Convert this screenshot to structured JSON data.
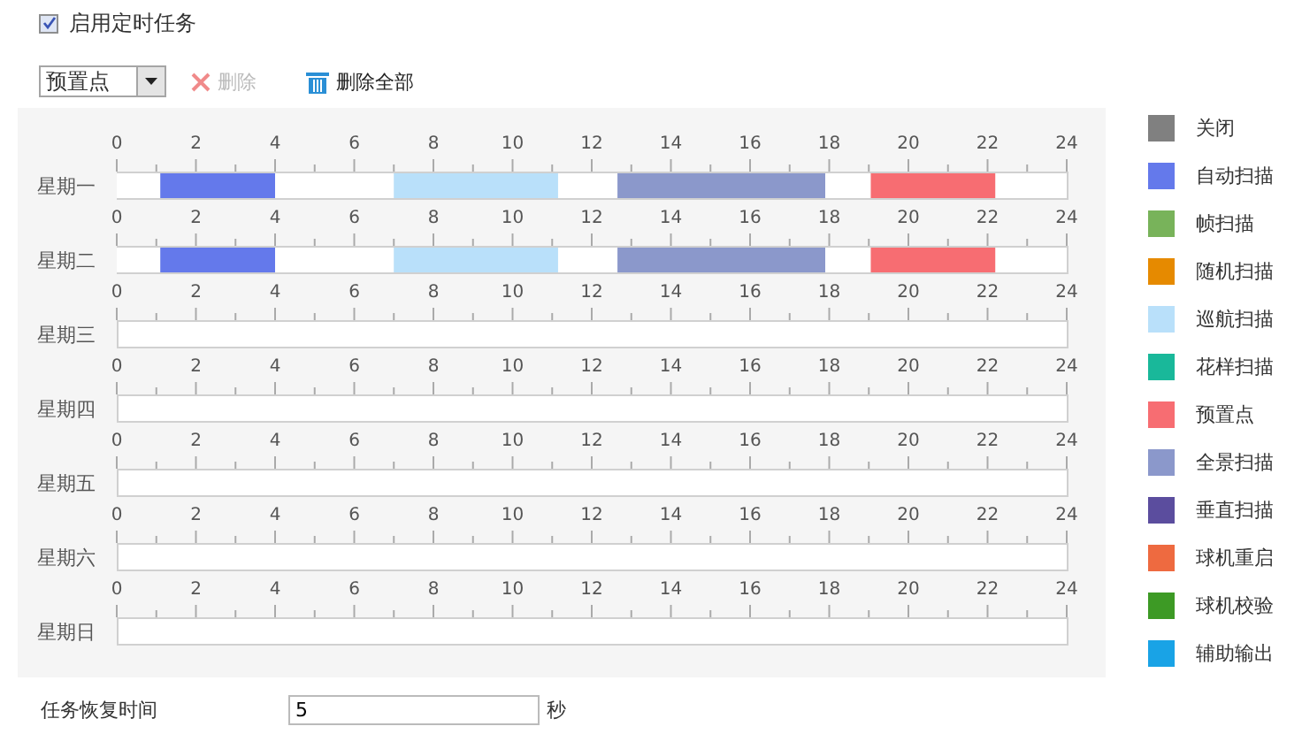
{
  "enable_checkbox": {
    "label": "启用定时任务",
    "checked": true
  },
  "toolbar": {
    "mode_select": {
      "value": "预置点"
    },
    "delete_button": {
      "label": "删除",
      "disabled": true
    },
    "delete_all_button": {
      "label": "删除全部",
      "disabled": false
    }
  },
  "schedule": {
    "chart_data": {
      "type": "bar",
      "orientation": "horizontal",
      "stacked": true,
      "categories": [
        "星期一",
        "星期二"
      ],
      "xlim": [
        0,
        24
      ],
      "xticks": [
        0,
        2,
        4,
        6,
        8,
        10,
        12,
        14,
        16,
        18,
        20,
        22,
        24
      ],
      "series": [
        {
          "color": "#ffffff",
          "values": [
            1.1,
            1.1
          ]
        },
        {
          "color": "#6479eb",
          "values": [
            2.9,
            2.9
          ]
        },
        {
          "color": "#ffffff",
          "values": [
            3,
            3
          ]
        },
        {
          "color": "#b9e0fa",
          "values": [
            4.15,
            4.15
          ]
        },
        {
          "color": "#ffffff",
          "values": [
            1.5,
            1.5
          ]
        },
        {
          "color": "#8b98cb",
          "values": [
            5.25,
            5.25
          ]
        },
        {
          "color": "#ffffff",
          "values": [
            1.15,
            1.15
          ]
        },
        {
          "color": "#f76d72",
          "values": [
            3.15,
            3.15
          ]
        },
        {
          "color": "#ffffff",
          "values": [
            1.8,
            1.8
          ]
        }
      ]
    },
    "second_row_ticks": [
      "0",
      "2",
      "4",
      "6",
      "8",
      "10",
      "12",
      "14",
      "16",
      "18",
      "20",
      "22",
      "24"
    ]
  },
  "days": [
    {
      "label": "星期三",
      "ticks": [
        "0",
        "2",
        "4",
        "6",
        "8",
        "10",
        "12",
        "14",
        "16",
        "18",
        "20",
        "22",
        "24"
      ]
    },
    {
      "label": "星期四",
      "ticks": [
        "0",
        "2",
        "4",
        "6",
        "8",
        "10",
        "12",
        "14",
        "16",
        "18",
        "20",
        "22",
        "24"
      ]
    },
    {
      "label": "星期五",
      "ticks": [
        "0",
        "2",
        "4",
        "6",
        "8",
        "10",
        "12",
        "14",
        "16",
        "18",
        "20",
        "22",
        "24"
      ]
    },
    {
      "label": "星期六",
      "ticks": [
        "0",
        "2",
        "4",
        "6",
        "8",
        "10",
        "12",
        "14",
        "16",
        "18",
        "20",
        "22",
        "24"
      ]
    },
    {
      "label": "星期日",
      "ticks": [
        "0",
        "2",
        "4",
        "6",
        "8",
        "10",
        "12",
        "14",
        "16",
        "18",
        "20",
        "22",
        "24"
      ]
    }
  ],
  "legend": [
    {
      "label": "关闭",
      "color": "#808080"
    },
    {
      "label": "自动扫描",
      "color": "#6479eb"
    },
    {
      "label": "帧扫描",
      "color": "#78b35a"
    },
    {
      "label": "随机扫描",
      "color": "#e68a00"
    },
    {
      "label": "巡航扫描",
      "color": "#b9e0fa"
    },
    {
      "label": "花样扫描",
      "color": "#19b89a"
    },
    {
      "label": "预置点",
      "color": "#f76d72"
    },
    {
      "label": "全景扫描",
      "color": "#8b98cb"
    },
    {
      "label": "垂直扫描",
      "color": "#5b4d9e"
    },
    {
      "label": "球机重启",
      "color": "#ee6a40"
    },
    {
      "label": "球机校验",
      "color": "#3d9a25"
    },
    {
      "label": "辅助输出",
      "color": "#19a3e6"
    }
  ],
  "recovery": {
    "label": "任务恢复时间",
    "value": "5",
    "unit": "秒"
  }
}
